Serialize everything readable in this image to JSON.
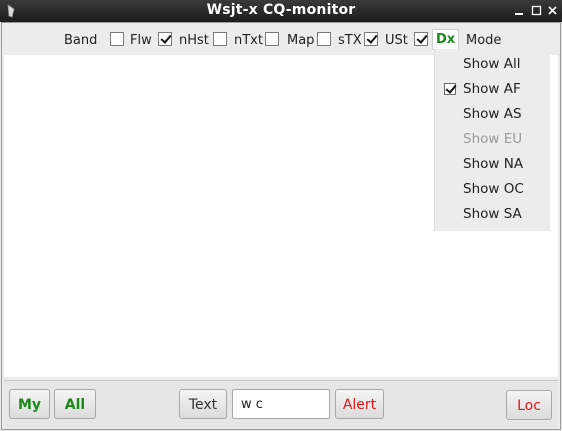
{
  "window": {
    "title": "Wsjt-x CQ-monitor",
    "minimize_glyph": "_",
    "maximize_glyph": "□",
    "close_glyph": "✕",
    "icon": "app-icon"
  },
  "toolbar": {
    "band_label": "Band",
    "flw": {
      "label": "Flw",
      "checked": false
    },
    "nhst": {
      "label": "nHst",
      "checked": true
    },
    "ntxt": {
      "label": "nTxt",
      "checked": false
    },
    "map": {
      "label": "Map",
      "checked": false
    },
    "stx": {
      "label": "sTX",
      "checked": false
    },
    "ust": {
      "label": "USt",
      "checked": true
    },
    "dx": {
      "label": "Dx",
      "checked": true,
      "color": "#1a8a1a"
    },
    "mode_label": "Mode"
  },
  "menu": {
    "items": [
      {
        "label": "Show All",
        "checked": false,
        "enabled": true
      },
      {
        "label": "Show AF",
        "checked": true,
        "enabled": true
      },
      {
        "label": "Show AS",
        "checked": false,
        "enabled": true
      },
      {
        "label": "Show EU",
        "checked": false,
        "enabled": false
      },
      {
        "label": "Show NA",
        "checked": false,
        "enabled": true
      },
      {
        "label": "Show OC",
        "checked": false,
        "enabled": true
      },
      {
        "label": "Show SA",
        "checked": false,
        "enabled": true
      }
    ]
  },
  "bottom": {
    "my_label": "My",
    "all_label": "All",
    "text_label": "Text",
    "text_value": "w c",
    "alert_label": "Alert",
    "loc_label": "Loc"
  },
  "colors": {
    "green": "#1a8a1a",
    "red": "#e01818",
    "title_bg": "#2a2a2a"
  }
}
